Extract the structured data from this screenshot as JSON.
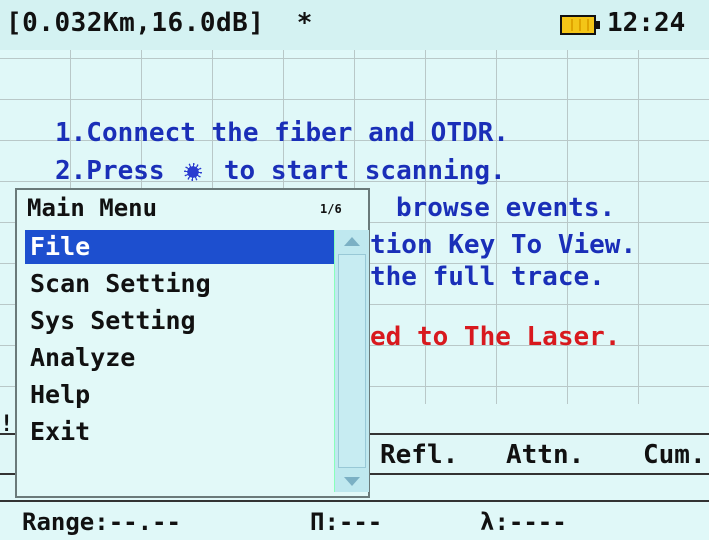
{
  "status_bar": {
    "title": "[0.032Km,16.0dB]  *",
    "battery_icon": "battery-icon",
    "time": "12:24"
  },
  "hints": {
    "line1": "1.Connect the fiber and OTDR.",
    "line2_prefix": "2.Press ",
    "line2_icon": "laser-start-icon",
    "line2_suffix": " to start scanning.",
    "line3_visible": "browse events.",
    "line4_visible": "tion Key To View.",
    "line5_visible": "the full trace.",
    "warning_visible": "ed to The Laser."
  },
  "left_mark": "!",
  "event_table": {
    "columns": [
      "Refl.",
      "Attn.",
      "Cum."
    ]
  },
  "bottom_status": {
    "range": "Range:--.--",
    "pulse": "П:---",
    "wavelength": "λ:----"
  },
  "menu": {
    "title": "Main Menu",
    "page": "1/6",
    "items": [
      {
        "label": "File",
        "selected": true
      },
      {
        "label": "Scan Setting",
        "selected": false
      },
      {
        "label": "Sys Setting",
        "selected": false
      },
      {
        "label": "Analyze",
        "selected": false
      },
      {
        "label": "Help",
        "selected": false
      },
      {
        "label": "Exit",
        "selected": false
      }
    ]
  },
  "colors": {
    "background": "#e0f8f8",
    "hint_text": "#1a2fb8",
    "warning_text": "#d8191e",
    "selection": "#1d4fcf"
  }
}
